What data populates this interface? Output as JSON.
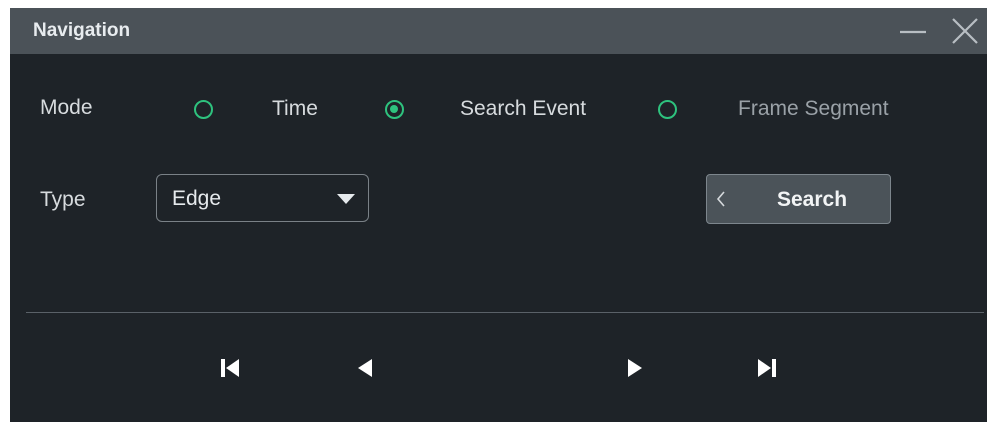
{
  "window": {
    "title": "Navigation",
    "controls": [
      "minimize-icon",
      "close-icon"
    ]
  },
  "mode": {
    "label": "Mode",
    "options": [
      {
        "label": "Time",
        "selected": false,
        "enabled": true
      },
      {
        "label": "Search Event",
        "selected": true,
        "enabled": true
      },
      {
        "label": "Frame Segment",
        "selected": false,
        "enabled": false
      }
    ]
  },
  "type": {
    "label": "Type",
    "value": "Edge"
  },
  "search_button": {
    "label": "Search"
  },
  "playback": {
    "buttons": [
      "skip-to-start-icon",
      "previous-icon",
      "next-icon",
      "skip-to-end-icon"
    ]
  },
  "colors": {
    "accent": "#2ec27e",
    "panel_bg": "#1e2328",
    "title_bar_bg": "#4b5258"
  }
}
